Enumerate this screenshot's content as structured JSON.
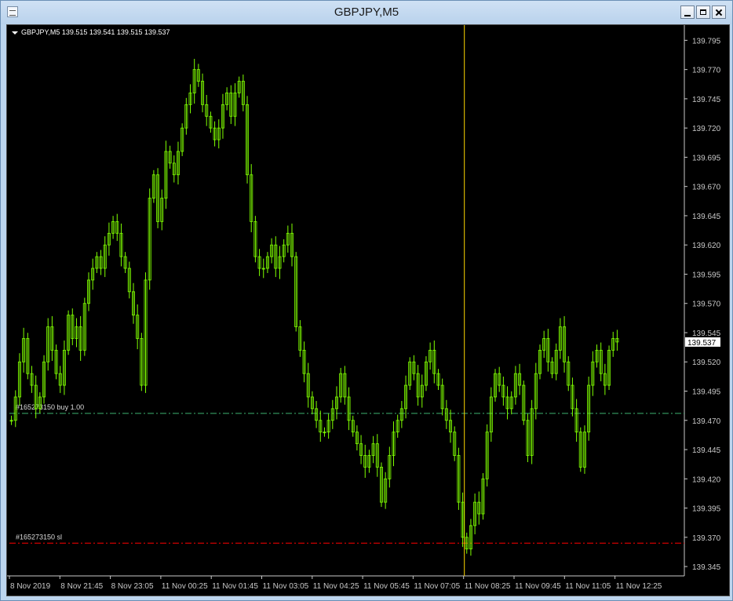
{
  "window": {
    "title": "GBPJPY,M5",
    "controls": [
      "minimize",
      "maximize",
      "close"
    ]
  },
  "colors": {
    "background": "#000000",
    "candle": "#7fff00",
    "axis": "#c8c8c8",
    "order_line": "#3cb371",
    "sl_line": "#ff0000",
    "crosshair": "#ffd700",
    "price_tag_bg": "#ffffff"
  },
  "chart_data": {
    "type": "line",
    "symbol_info": "GBPJPY,M5  139.515 139.541 139.515 139.537",
    "y_ticks": [
      139.795,
      139.77,
      139.745,
      139.72,
      139.695,
      139.67,
      139.645,
      139.62,
      139.595,
      139.57,
      139.545,
      139.52,
      139.495,
      139.47,
      139.445,
      139.42,
      139.395,
      139.37,
      139.345
    ],
    "y_tick_labels": [
      "139.795",
      "139.770",
      "139.745",
      "139.720",
      "139.695",
      "139.670",
      "139.645",
      "139.620",
      "139.595",
      "139.570",
      "139.545",
      "139.520",
      "139.495",
      "139.470",
      "139.445",
      "139.420",
      "139.395",
      "139.370",
      "139.345"
    ],
    "ylim": [
      139.337,
      139.808
    ],
    "x_tick_labels": [
      "8 Nov 2019",
      "8 Nov 21:45",
      "8 Nov 23:05",
      "11 Nov 00:25",
      "11 Nov 01:45",
      "11 Nov 03:05",
      "11 Nov 04:25",
      "11 Nov 05:45",
      "11 Nov 07:05",
      "11 Nov 08:25",
      "11 Nov 09:45",
      "11 Nov 11:05",
      "11 Nov 12:25"
    ],
    "current_price": "139.537",
    "order_line": {
      "label": "#165273150 buy 1.00",
      "price": 139.476
    },
    "sl_line": {
      "label": "#165273150 sl",
      "price": 139.365
    },
    "crosshair_x_label": "11 Nov 08:25",
    "series": [
      {
        "values": [
          139.47,
          139.49,
          139.52,
          139.54,
          139.51,
          139.5,
          139.48,
          139.49,
          139.52,
          139.55,
          139.53,
          139.51,
          139.5,
          139.53,
          139.56,
          139.54,
          139.55,
          139.53,
          139.57,
          139.59,
          139.6,
          139.61,
          139.6,
          139.62,
          139.63,
          139.64,
          139.63,
          139.61,
          139.6,
          139.58,
          139.56,
          139.54,
          139.5,
          139.59,
          139.66,
          139.68,
          139.64,
          139.66,
          139.7,
          139.69,
          139.68,
          139.7,
          139.72,
          139.74,
          139.75,
          139.77,
          139.76,
          139.74,
          139.73,
          139.72,
          139.71,
          139.72,
          139.74,
          139.75,
          139.73,
          139.75,
          139.76,
          139.74,
          139.68,
          139.64,
          139.61,
          139.6,
          139.6,
          139.61,
          139.62,
          139.6,
          139.61,
          139.62,
          139.63,
          139.61,
          139.55,
          139.53,
          139.51,
          139.49,
          139.48,
          139.47,
          139.46,
          139.46,
          139.47,
          139.48,
          139.49,
          139.51,
          139.49,
          139.47,
          139.46,
          139.45,
          139.44,
          139.43,
          139.44,
          139.45,
          139.43,
          139.4,
          139.42,
          139.44,
          139.46,
          139.47,
          139.48,
          139.5,
          139.52,
          139.51,
          139.49,
          139.5,
          139.52,
          139.53,
          139.51,
          139.5,
          139.48,
          139.47,
          139.46,
          139.44,
          139.4,
          139.37,
          139.36,
          139.38,
          139.4,
          139.39,
          139.42,
          139.46,
          139.49,
          139.51,
          139.5,
          139.49,
          139.48,
          139.49,
          139.51,
          139.5,
          139.47,
          139.44,
          139.48,
          139.51,
          139.53,
          139.54,
          139.52,
          139.51,
          139.53,
          139.55,
          139.52,
          139.5,
          139.48,
          139.46,
          139.43,
          139.46,
          139.5,
          139.52,
          139.53,
          139.51,
          139.5,
          139.53,
          139.54,
          139.537
        ]
      }
    ]
  }
}
